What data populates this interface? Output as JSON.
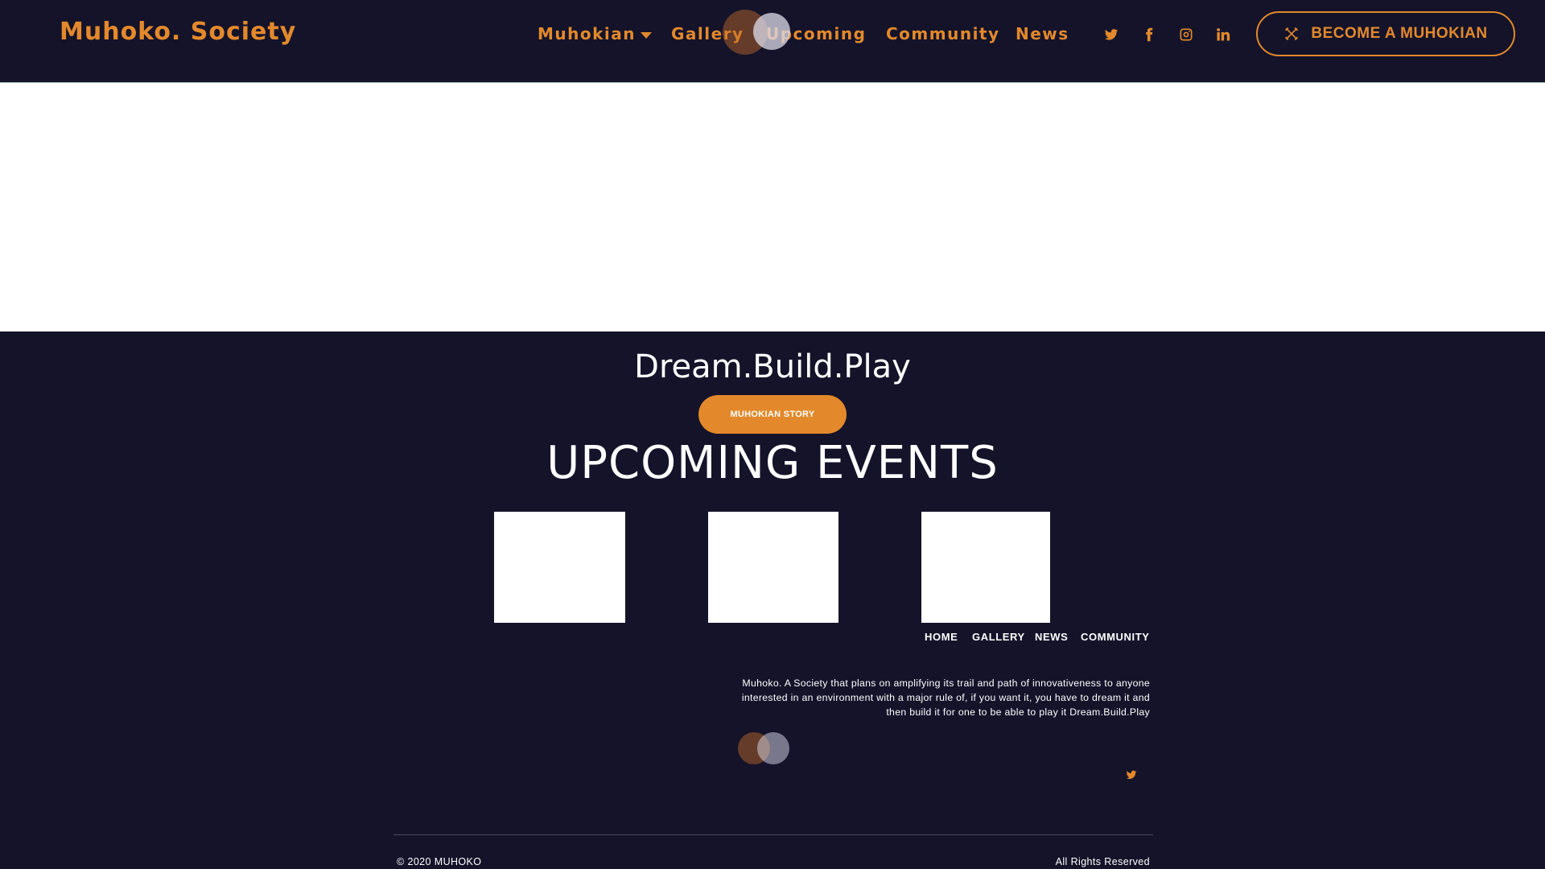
{
  "brand": {
    "name": "Muhoko. Society"
  },
  "nav": {
    "items": [
      {
        "label": "Muhokian",
        "has_dropdown": true
      },
      {
        "label": "Gallery"
      },
      {
        "label": "Upcoming"
      },
      {
        "label": "Community"
      },
      {
        "label": "News"
      }
    ]
  },
  "social": [
    "twitter-icon",
    "facebook-icon",
    "instagram-icon",
    "linkedin-icon"
  ],
  "cta": {
    "label": "BECOME A MUHOKIAN",
    "icon": "tools-icon"
  },
  "hero": {
    "tagline": "Dream.Build.Play",
    "story_button": "MUHOKIAN STORY"
  },
  "events": {
    "title": "UPCOMING EVENTS",
    "card_count": 3
  },
  "footer": {
    "nav": [
      "HOME",
      "GALLERY",
      "NEWS",
      "COMMUNITY"
    ],
    "description": "Muhoko. A Society that plans on amplifying its trail and path of innovativeness to anyone interested in an environment with a major rule of, if you want it, you have to dream it and then build it for one to be able to play it Dream.Build.Play",
    "social": [
      "twitter-icon"
    ],
    "copyright": "© 2020 MUHOKO",
    "rights": "All Rights Reserved"
  },
  "colors": {
    "background": "#14132a",
    "accent": "#e3892b",
    "text": "#ffffff",
    "hero_band": "#ffffff"
  }
}
